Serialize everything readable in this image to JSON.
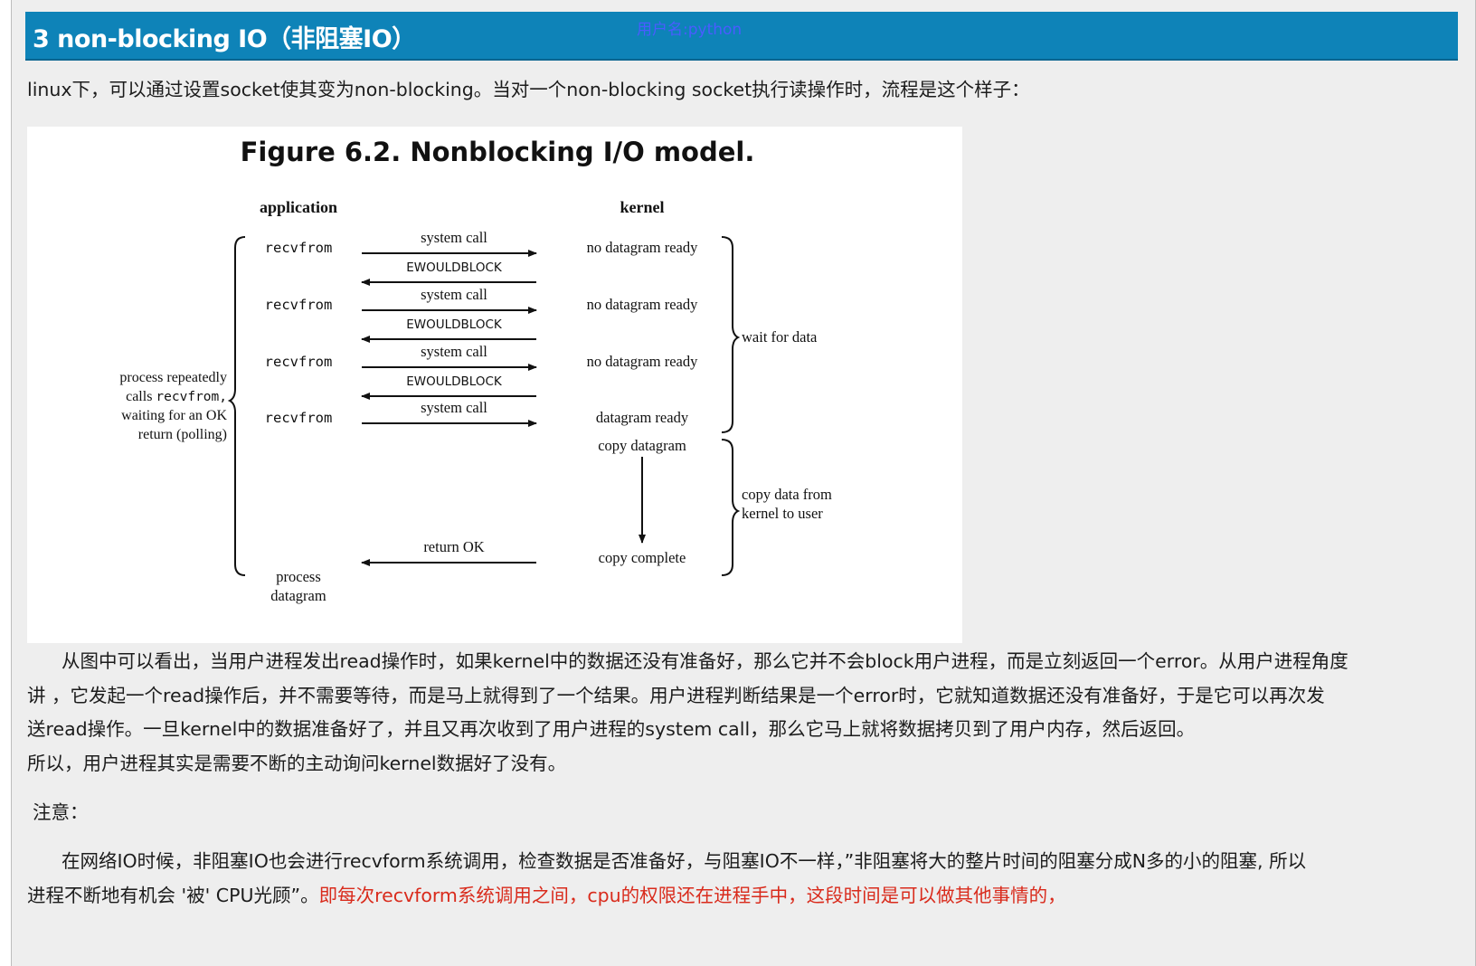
{
  "header": {
    "title": "3 non-blocking IO（非阻塞IO）",
    "watermark": "用户名:python"
  },
  "intro": "linux下，可以通过设置socket使其变为non-blocking。当对一个non-blocking socket执行读操作时，流程是这个样子：",
  "figure": {
    "title": "Figure 6.2. Nonblocking I/O model.",
    "col_app": "application",
    "col_kernel": "kernel",
    "rows": [
      {
        "app": "recvfrom",
        "call": "system call",
        "reply": "EWOULDBLOCK",
        "kernel": "no datagram ready"
      },
      {
        "app": "recvfrom",
        "call": "system call",
        "reply": "EWOULDBLOCK",
        "kernel": "no datagram ready"
      },
      {
        "app": "recvfrom",
        "call": "system call",
        "reply": "EWOULDBLOCK",
        "kernel": "no datagram ready"
      },
      {
        "app": "recvfrom",
        "call": "system call",
        "kernel": "datagram ready"
      }
    ],
    "copy_datagram": "copy datagram",
    "copy_complete": "copy complete",
    "return_ok": "return OK",
    "wait_for_data": "wait for data",
    "copy_data_1": "copy data from",
    "copy_data_2": "kernel to user",
    "left_note": {
      "l1": "process repeatedly",
      "l2a": "calls ",
      "l2b": "recvfrom,",
      "l3": "waiting for an OK",
      "l4": "return (polling)"
    },
    "process_1": "process",
    "process_2": "datagram"
  },
  "para1": {
    "l1": "从图中可以看出，当用户进程发出read操作时，如果kernel中的数据还没有准备好，那么它并不会block用户进程，而是立刻返回一个error。从用户进程角度",
    "l2": "讲 ，它发起一个read操作后，并不需要等待，而是马上就得到了一个结果。用户进程判断结果是一个error时，它就知道数据还没有准备好，于是它可以再次发",
    "l3": "送read操作。一旦kernel中的数据准备好了，并且又再次收到了用户进程的system call，那么它马上就将数据拷贝到了用户内存，然后返回。",
    "l4": "所以，用户进程其实是需要不断的主动询问kernel数据好了没有。"
  },
  "note_label": "注意：",
  "para2": {
    "l1": "在网络IO时候，非阻塞IO也会进行recvform系统调用，检查数据是否准备好，与阻塞IO不一样，”非阻塞将大的整片时间的阻塞分成N多的小的阻塞, 所以",
    "l2": "进程不断地有机会 '被' CPU光顾”。",
    "l2_red": "即每次recvform系统调用之间，cpu的权限还在进程手中，这段时间是可以做其他事情的，"
  },
  "colors": {
    "header": "#0e83b8",
    "watermark": "#4a5cff",
    "highlight": "#d92b1c"
  }
}
